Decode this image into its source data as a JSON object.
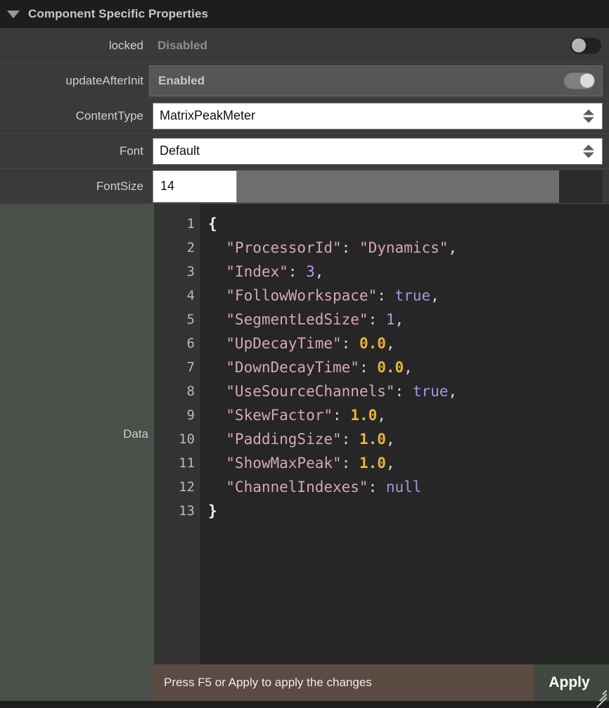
{
  "header": {
    "title": "Component Specific Properties",
    "disclosure_icon": "triangle-down-icon"
  },
  "properties": [
    {
      "label": "locked",
      "value": "Disabled",
      "toggle": "off",
      "highlighted": false
    },
    {
      "label": "updateAfterInit",
      "value": "Enabled",
      "toggle": "on",
      "highlighted": true
    }
  ],
  "combos": [
    {
      "label": "ContentType",
      "value": "MatrixPeakMeter",
      "arrows_icon": "spinner-arrows-icon"
    },
    {
      "label": "Font",
      "value": "Default",
      "arrows_icon": "spinner-arrows-icon"
    }
  ],
  "fontsize": {
    "label": "FontSize",
    "value": "14",
    "slider_fill_percent": "88"
  },
  "editor": {
    "label": "Data",
    "line_numbers": [
      "1",
      "2",
      "3",
      "4",
      "5",
      "6",
      "7",
      "8",
      "9",
      "10",
      "11",
      "12",
      "13"
    ],
    "lines": [
      [
        {
          "t": "brace",
          "s": "{"
        }
      ],
      [
        {
          "t": "key",
          "s": "  \"ProcessorId\""
        },
        {
          "t": "punct",
          "s": ": "
        },
        {
          "t": "string",
          "s": "\"Dynamics\""
        },
        {
          "t": "punct",
          "s": ","
        }
      ],
      [
        {
          "t": "key",
          "s": "  \"Index\""
        },
        {
          "t": "punct",
          "s": ": "
        },
        {
          "t": "int",
          "s": "3"
        },
        {
          "t": "punct",
          "s": ","
        }
      ],
      [
        {
          "t": "key",
          "s": "  \"FollowWorkspace\""
        },
        {
          "t": "punct",
          "s": ": "
        },
        {
          "t": "bool",
          "s": "true"
        },
        {
          "t": "punct",
          "s": ","
        }
      ],
      [
        {
          "t": "key",
          "s": "  \"SegmentLedSize\""
        },
        {
          "t": "punct",
          "s": ": "
        },
        {
          "t": "int",
          "s": "1"
        },
        {
          "t": "punct",
          "s": ","
        }
      ],
      [
        {
          "t": "key",
          "s": "  \"UpDecayTime\""
        },
        {
          "t": "punct",
          "s": ": "
        },
        {
          "t": "float",
          "s": "0.0"
        },
        {
          "t": "punct",
          "s": ","
        }
      ],
      [
        {
          "t": "key",
          "s": "  \"DownDecayTime\""
        },
        {
          "t": "punct",
          "s": ": "
        },
        {
          "t": "float",
          "s": "0.0"
        },
        {
          "t": "punct",
          "s": ","
        }
      ],
      [
        {
          "t": "key",
          "s": "  \"UseSourceChannels\""
        },
        {
          "t": "punct",
          "s": ": "
        },
        {
          "t": "bool",
          "s": "true"
        },
        {
          "t": "punct",
          "s": ","
        }
      ],
      [
        {
          "t": "key",
          "s": "  \"SkewFactor\""
        },
        {
          "t": "punct",
          "s": ": "
        },
        {
          "t": "float",
          "s": "1.0"
        },
        {
          "t": "punct",
          "s": ","
        }
      ],
      [
        {
          "t": "key",
          "s": "  \"PaddingSize\""
        },
        {
          "t": "punct",
          "s": ": "
        },
        {
          "t": "float",
          "s": "1.0"
        },
        {
          "t": "punct",
          "s": ","
        }
      ],
      [
        {
          "t": "key",
          "s": "  \"ShowMaxPeak\""
        },
        {
          "t": "punct",
          "s": ": "
        },
        {
          "t": "float",
          "s": "1.0"
        },
        {
          "t": "punct",
          "s": ","
        }
      ],
      [
        {
          "t": "key",
          "s": "  \"ChannelIndexes\""
        },
        {
          "t": "punct",
          "s": ": "
        },
        {
          "t": "null",
          "s": "null"
        }
      ],
      [
        {
          "t": "brace",
          "s": "}"
        }
      ]
    ]
  },
  "status": {
    "message": "Press F5 or Apply to apply the changes",
    "apply_label": "Apply",
    "resize_icon": "resize-grip-icon"
  },
  "colors": {
    "panel_bg": "#3a3a3a",
    "header_bg": "#1d1d1d",
    "sidebar_green": "#4a5049",
    "code_bg": "#262626",
    "gutter_bg": "#333333",
    "status_bg": "#5b4b42",
    "apply_bg": "#414840",
    "key_color": "#d8a8ae",
    "float_color": "#e8b339",
    "int_color": "#c397e0",
    "bool_color": "#9a9ae8"
  }
}
